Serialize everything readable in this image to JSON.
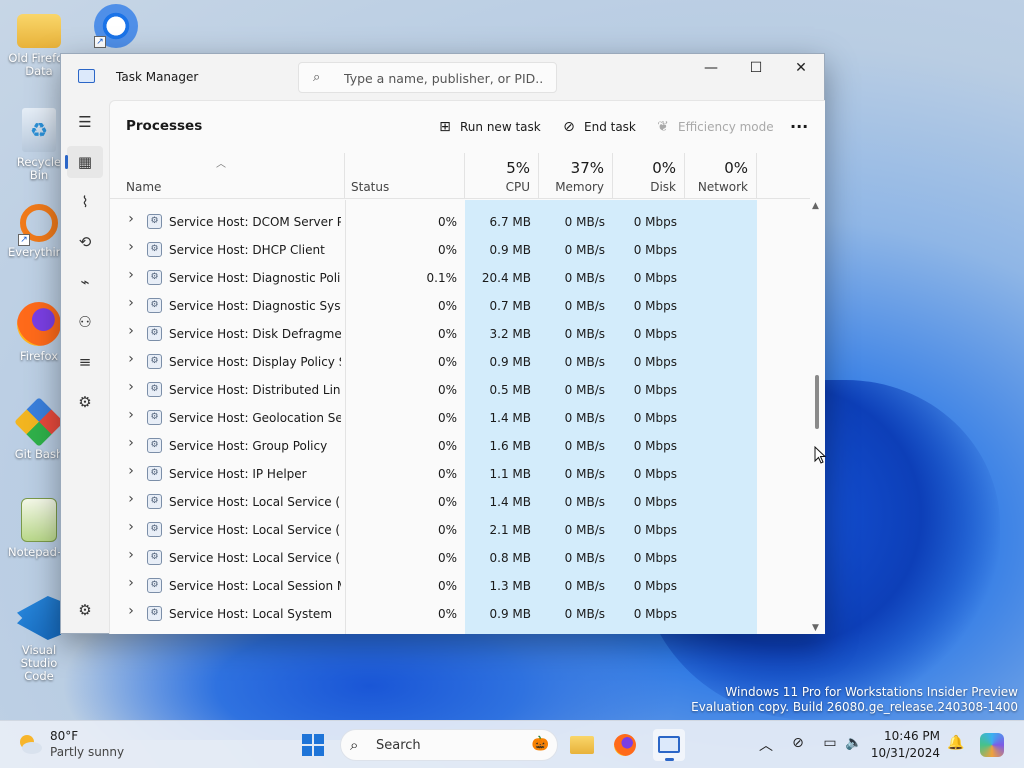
{
  "desktop": {
    "icons": [
      {
        "label": "Old Firefox Data"
      },
      {
        "label": "Recycle Bin"
      },
      {
        "label": "Everything"
      },
      {
        "label": "Firefox"
      },
      {
        "label": "Git Bash"
      },
      {
        "label": "Notepad++"
      },
      {
        "label": "Visual Studio Code"
      }
    ],
    "watermark_line1": "Windows 11 Pro for Workstations Insider Preview",
    "watermark_line2": "Evaluation copy. Build 26080.ge_release.240308-1400"
  },
  "window": {
    "title": "Task Manager",
    "search_placeholder": "Type a name, publisher, or PID...",
    "minimize": "—",
    "maximize": "☐",
    "close": "✕"
  },
  "rail": {
    "icons": [
      "hamburger-menu-icon",
      "processes-icon",
      "performance-icon",
      "app-history-icon",
      "startup-apps-icon",
      "users-icon",
      "details-icon",
      "services-icon",
      "settings-icon"
    ]
  },
  "commandbar": {
    "page_title": "Processes",
    "run_new_task": "Run new task",
    "end_task": "End task",
    "efficiency_mode": "Efficiency mode",
    "more": "···"
  },
  "table": {
    "headers": {
      "name": "Name",
      "status": "Status",
      "cpu_pct": "5%",
      "cpu": "CPU",
      "memory_pct": "37%",
      "memory": "Memory",
      "disk_pct": "0%",
      "disk": "Disk",
      "network_pct": "0%",
      "network": "Network"
    },
    "rows": [
      {
        "name": "Service Host: DCOM Server Pr...",
        "status": "",
        "cpu": "0%",
        "memory": "6.7 MB",
        "disk": "0 MB/s",
        "network": "0 Mbps"
      },
      {
        "name": "Service Host: DHCP Client",
        "status": "",
        "cpu": "0%",
        "memory": "0.9 MB",
        "disk": "0 MB/s",
        "network": "0 Mbps"
      },
      {
        "name": "Service Host: Diagnostic Polic...",
        "status": "",
        "cpu": "0.1%",
        "memory": "20.4 MB",
        "disk": "0 MB/s",
        "network": "0 Mbps"
      },
      {
        "name": "Service Host: Diagnostic Syste...",
        "status": "",
        "cpu": "0%",
        "memory": "0.7 MB",
        "disk": "0 MB/s",
        "network": "0 Mbps"
      },
      {
        "name": "Service Host: Disk Defragmenter",
        "status": "",
        "cpu": "0%",
        "memory": "3.2 MB",
        "disk": "0 MB/s",
        "network": "0 Mbps"
      },
      {
        "name": "Service Host: Display Policy Se...",
        "status": "",
        "cpu": "0%",
        "memory": "0.9 MB",
        "disk": "0 MB/s",
        "network": "0 Mbps"
      },
      {
        "name": "Service Host: Distributed Link ...",
        "status": "",
        "cpu": "0%",
        "memory": "0.5 MB",
        "disk": "0 MB/s",
        "network": "0 Mbps"
      },
      {
        "name": "Service Host: Geolocation Serv...",
        "status": "",
        "cpu": "0%",
        "memory": "1.4 MB",
        "disk": "0 MB/s",
        "network": "0 Mbps"
      },
      {
        "name": "Service Host: Group Policy",
        "status": "",
        "cpu": "0%",
        "memory": "1.6 MB",
        "disk": "0 MB/s",
        "network": "0 Mbps"
      },
      {
        "name": "Service Host: IP Helper",
        "status": "",
        "cpu": "0%",
        "memory": "1.1 MB",
        "disk": "0 MB/s",
        "network": "0 Mbps"
      },
      {
        "name": "Service Host: Local Service (N...",
        "status": "",
        "cpu": "0%",
        "memory": "1.4 MB",
        "disk": "0 MB/s",
        "network": "0 Mbps"
      },
      {
        "name": "Service Host: Local Service (N...",
        "status": "",
        "cpu": "0%",
        "memory": "2.1 MB",
        "disk": "0 MB/s",
        "network": "0 Mbps"
      },
      {
        "name": "Service Host: Local Service (N...",
        "status": "",
        "cpu": "0%",
        "memory": "0.8 MB",
        "disk": "0 MB/s",
        "network": "0 Mbps"
      },
      {
        "name": "Service Host: Local Session M...",
        "status": "",
        "cpu": "0%",
        "memory": "1.3 MB",
        "disk": "0 MB/s",
        "network": "0 Mbps"
      },
      {
        "name": "Service Host: Local System",
        "status": "",
        "cpu": "0%",
        "memory": "0.9 MB",
        "disk": "0 MB/s",
        "network": "0 Mbps"
      }
    ]
  },
  "taskbar": {
    "weather_temp": "80°F",
    "weather_desc": "Partly sunny",
    "search_label": "Search",
    "clock_time": "10:46 PM",
    "clock_date": "10/31/2024"
  },
  "colors": {
    "accent": "#2b66c7",
    "heat_column": "#d3ecfb"
  }
}
